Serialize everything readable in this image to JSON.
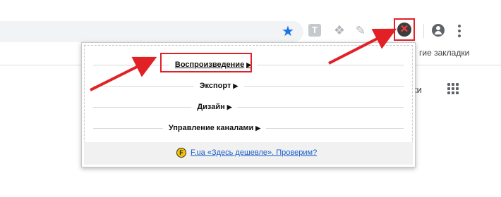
{
  "browser": {
    "bookmarks_text": "гие закладки",
    "page_fragment": "вки"
  },
  "extensions": {
    "t_label": "T"
  },
  "popup": {
    "menu": [
      {
        "label": "Воспроизведение"
      },
      {
        "label": "Экспорт"
      },
      {
        "label": "Дизайн"
      },
      {
        "label": "Управление каналами"
      }
    ],
    "footer_badge": "F",
    "footer_link": "F.ua «Здесь дешевле». Проверим?"
  },
  "colors": {
    "annotation_red": "#e12126",
    "star_blue": "#1a73e8",
    "link_blue": "#1a5ecc"
  }
}
